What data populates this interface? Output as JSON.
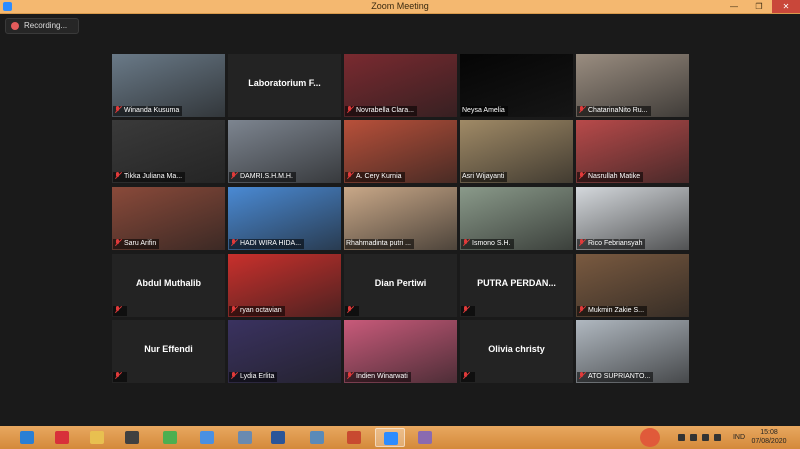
{
  "window": {
    "title": "Zoom Meeting",
    "minimize": "—",
    "restore": "❐",
    "close": "✕"
  },
  "recording": {
    "label": "Recording..."
  },
  "colors": {
    "active_border": "#a8d64a",
    "mic_muted": "#e03a3a",
    "tile_bg": "#232323"
  },
  "tiles": [
    {
      "name": "Winanda Kusuma",
      "big": "",
      "muted": true,
      "video": "#6a7a88"
    },
    {
      "name": "",
      "big": "Laboratorium  F...",
      "muted": false,
      "video": ""
    },
    {
      "name": "Novrabella Clara...",
      "big": "",
      "muted": true,
      "video": "#7a2a30"
    },
    {
      "name": "Neysa Amelia",
      "big": "",
      "muted": false,
      "video": "#050505"
    },
    {
      "name": "ChatarinaNito Ru...",
      "big": "",
      "muted": true,
      "video": "#9a8d80"
    },
    {
      "name": "Tikka Juliana Ma...",
      "big": "",
      "muted": true,
      "video": "#3a3a3a"
    },
    {
      "name": "DAMRI.S.H.M.H.",
      "big": "",
      "muted": true,
      "video": "#7d8590"
    },
    {
      "name": "A. Cery Kurnia",
      "big": "",
      "muted": true,
      "video": "#b8503a"
    },
    {
      "name": "Asri Wijayanti",
      "big": "",
      "muted": false,
      "video": "#a08a66",
      "active": true
    },
    {
      "name": "Nasrullah Matike",
      "big": "",
      "muted": true,
      "video": "#b84a4a"
    },
    {
      "name": "Saru Arifin",
      "big": "",
      "muted": true,
      "video": "#8a4a3a"
    },
    {
      "name": "HADI WIRA HIDA...",
      "big": "",
      "muted": true,
      "video": "#4a8ad4"
    },
    {
      "name": "Rhahmadinta putri ...",
      "big": "",
      "muted": false,
      "video": "#c9a888"
    },
    {
      "name": "Ismono  S.H.",
      "big": "",
      "muted": true,
      "video": "#8a9a8a"
    },
    {
      "name": "Rico Febriansyah",
      "big": "",
      "muted": true,
      "video": "#d4d8dc"
    },
    {
      "name": "",
      "big": "Abdul Muthalib",
      "muted": true,
      "video": ""
    },
    {
      "name": "ryan octavian",
      "big": "",
      "muted": true,
      "video": "#c9302c"
    },
    {
      "name": "",
      "big": "Dian Pertiwi",
      "muted": true,
      "video": ""
    },
    {
      "name": "",
      "big": "PUTRA  PERDAN...",
      "muted": true,
      "video": ""
    },
    {
      "name": "Mukmin Zakie S...",
      "big": "",
      "muted": true,
      "video": "#7a5a40"
    },
    {
      "name": "",
      "big": "Nur Effendi",
      "muted": true,
      "video": ""
    },
    {
      "name": "Lydia Erlita",
      "big": "",
      "muted": true,
      "video": "#3a3260"
    },
    {
      "name": "Indien Winarwati",
      "big": "",
      "muted": true,
      "video": "#c85a7a"
    },
    {
      "name": "",
      "big": "Olivia christy",
      "muted": true,
      "video": ""
    },
    {
      "name": "ATO SUPRIANTO...",
      "big": "",
      "muted": true,
      "video": "#b0b8c0"
    }
  ],
  "taskbar": {
    "icons": [
      {
        "name": "ie-icon",
        "color": "#2a7fd4"
      },
      {
        "name": "apps-icon",
        "color": "#d8303a"
      },
      {
        "name": "explorer-icon",
        "color": "#e8c050"
      },
      {
        "name": "user-icon",
        "color": "#404040"
      },
      {
        "name": "chrome-icon",
        "color": "#4caf50"
      },
      {
        "name": "zoom-app-icon",
        "color": "#4a90e2"
      },
      {
        "name": "window-icon",
        "color": "#6a8ab0"
      },
      {
        "name": "word-icon",
        "color": "#2a5599"
      },
      {
        "name": "photos-icon",
        "color": "#5a8ab8"
      },
      {
        "name": "powerpoint-icon",
        "color": "#c84a30"
      },
      {
        "name": "zoom-meeting-icon",
        "color": "#2d8cff",
        "active": true
      },
      {
        "name": "paint-icon",
        "color": "#8a6ab0"
      }
    ],
    "language": "IND",
    "time": "15:08",
    "date": "07/08/2020"
  }
}
